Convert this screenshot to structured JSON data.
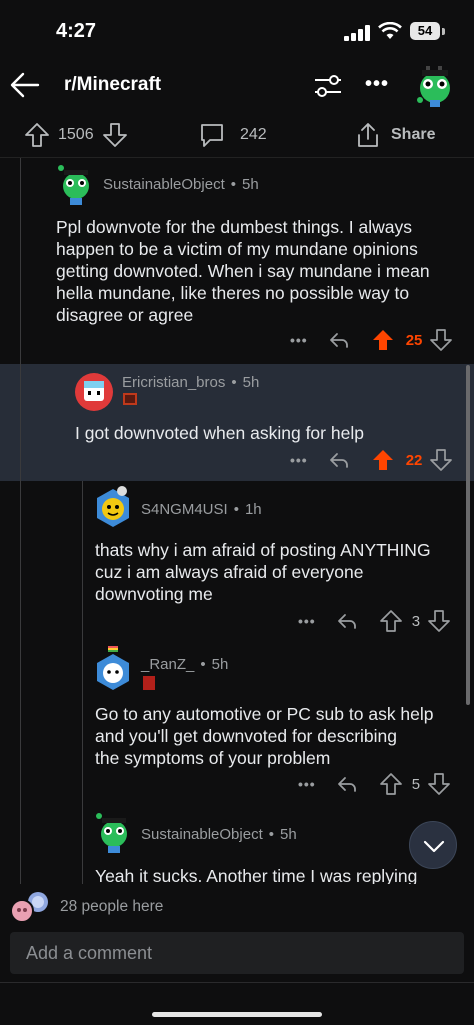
{
  "status": {
    "time": "4:27",
    "battery": "54"
  },
  "nav": {
    "subreddit": "r/Minecraft"
  },
  "post_actions": {
    "upvotes": "1506",
    "comments": "242",
    "share": "Share"
  },
  "comments": [
    {
      "user": "SustainableObject",
      "time": "5h",
      "lines": [
        "Ppl downvote for the dumbest things. I always",
        "happen to be a victim of my mundane opinions",
        "getting downvoted. When i say mundane i mean",
        "hella mundane, like theres no possible way to",
        "disagree or agree"
      ],
      "score": "25"
    },
    {
      "user": "Ericristian_bros",
      "time": "5h",
      "lines": [
        "I got downvoted when asking for help"
      ],
      "score": "22"
    },
    {
      "user": "S4NGM4USI",
      "time": "1h",
      "lines": [
        "thats why i am afraid of posting ANYTHING",
        "cuz i am always afraid of everyone",
        "downvoting me"
      ],
      "score": "3"
    },
    {
      "user": "_RanZ_",
      "time": "5h",
      "lines": [
        "Go to any automotive or PC sub to ask help",
        "and you'll get downvoted for describing",
        "the symptoms of your problem"
      ],
      "score": "5"
    },
    {
      "user": "SustainableObject",
      "time": "5h",
      "lines": [
        "Yeah it sucks. Another time I was replying"
      ]
    }
  ],
  "presence": {
    "text": "28 people here"
  },
  "input": {
    "placeholder": "Add a comment"
  },
  "colors": {
    "upvote": "#ff4500",
    "background": "#0e0e0f",
    "highlight": "#272d38"
  },
  "icons": [
    "back-arrow-icon",
    "filter-icon",
    "more-icon",
    "upvote-icon",
    "downvote-icon",
    "comment-icon",
    "share-icon",
    "reply-icon",
    "chevron-down-icon"
  ]
}
